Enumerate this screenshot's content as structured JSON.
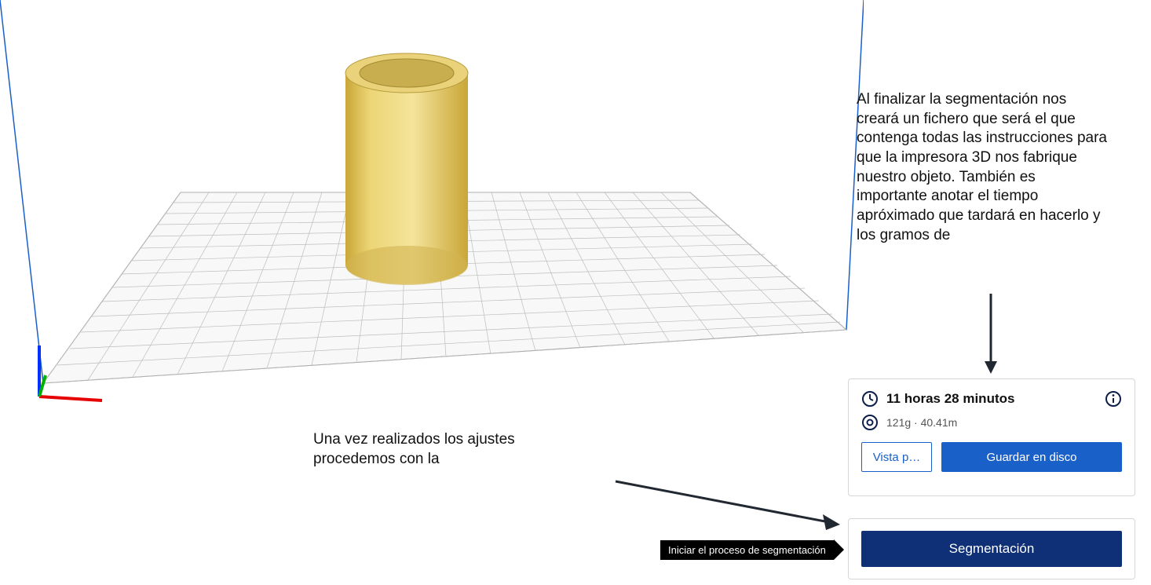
{
  "annotations": {
    "top": "Al finalizar la segmentación nos creará un fichero que será el que contenga todas las instrucciones para que la impresora 3D nos fabrique nuestro objeto. También es importante anotar el tiempo apróximado que tardará en hacerlo y los gramos de",
    "bottom": "Una vez realizados los ajustes procedemos con la"
  },
  "info": {
    "time": "11 horas 28 minutos",
    "material": "121g · 40.41m",
    "preview_button": "Vista p…",
    "save_button": "Guardar en disco"
  },
  "segmentation": {
    "button": "Segmentación",
    "tooltip": "Iniciar el proceso de segmentación"
  }
}
